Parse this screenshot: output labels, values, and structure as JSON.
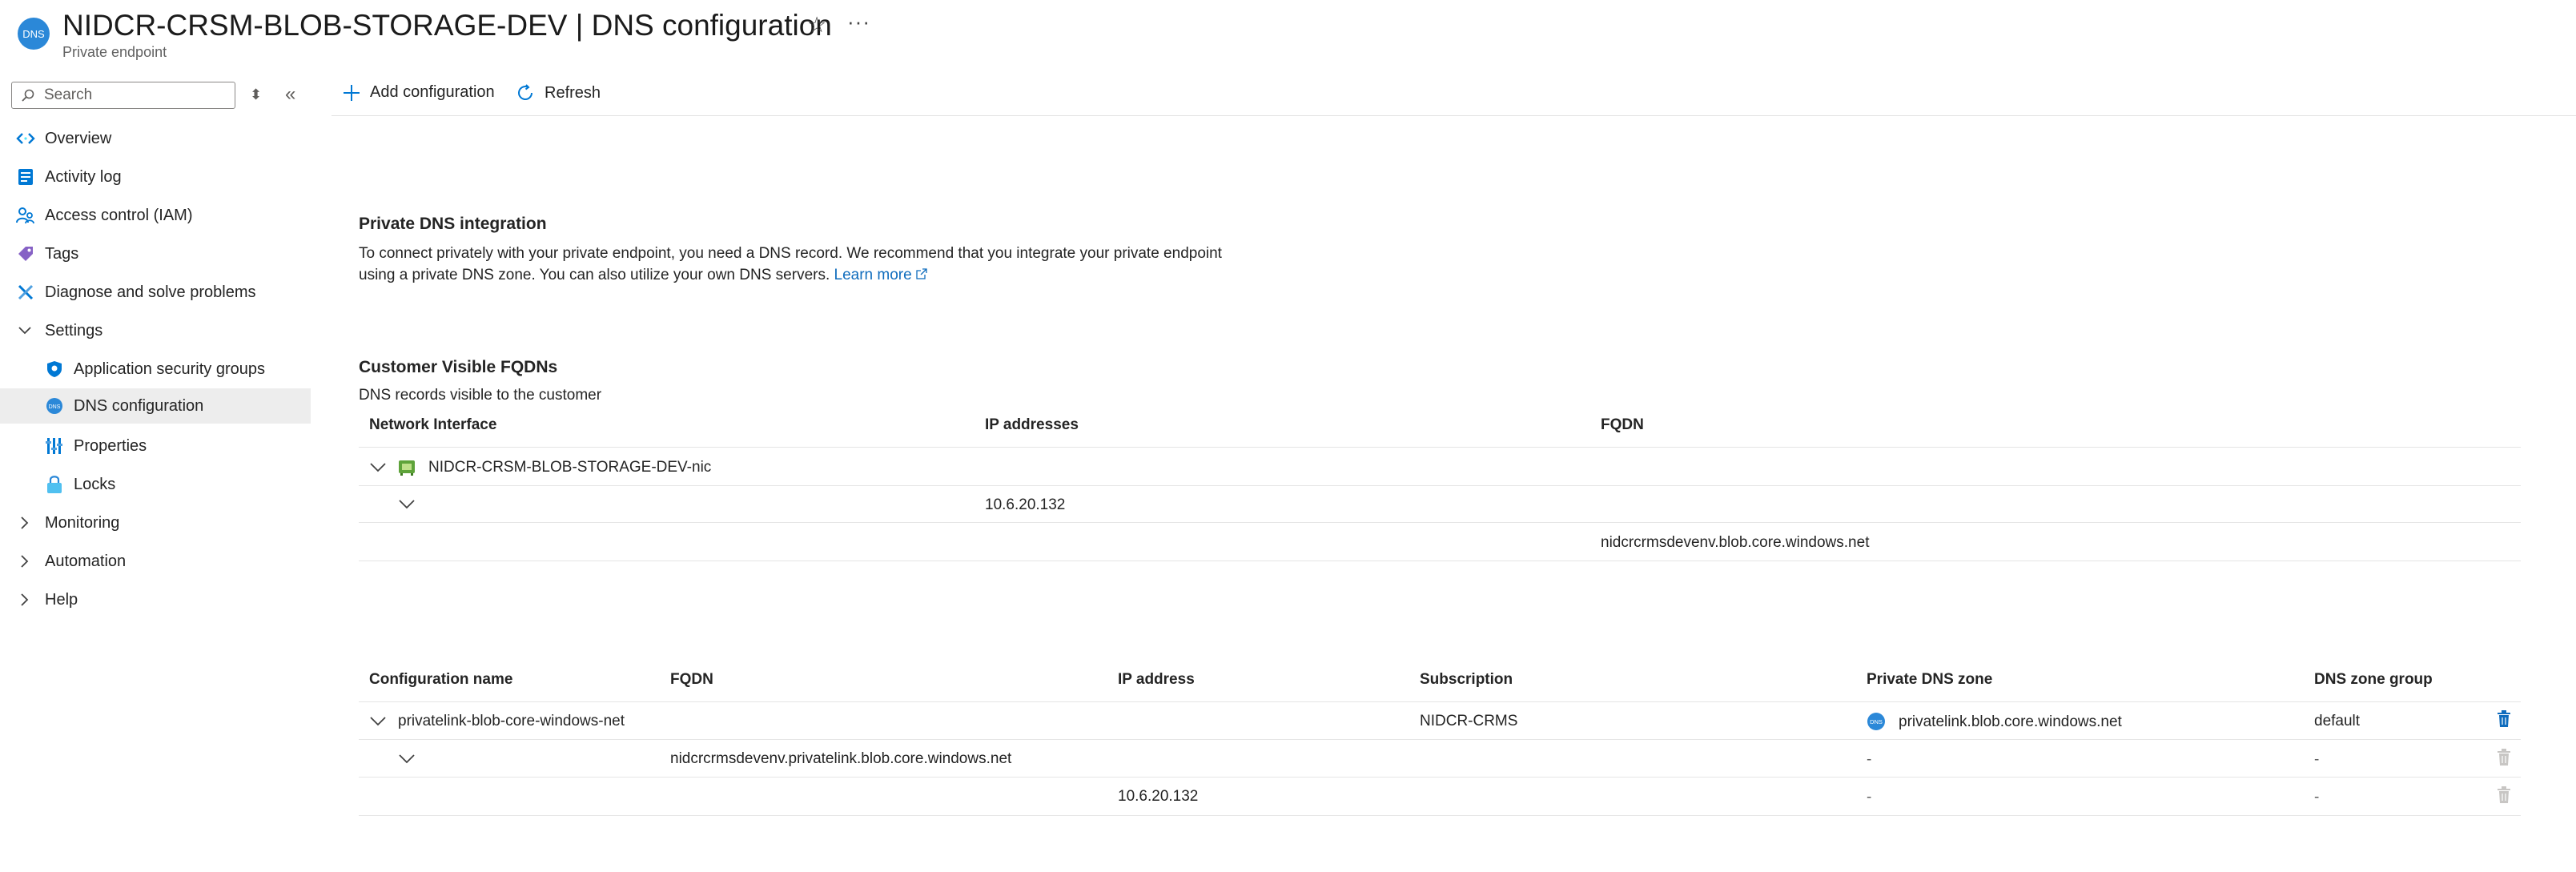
{
  "header": {
    "icon_text": "DNS",
    "title": "NIDCR-CRSM-BLOB-STORAGE-DEV | DNS configuration",
    "subtitle": "Private endpoint",
    "favorite_icon": "star-icon",
    "more_icon": "ellipsis-icon",
    "more_text": "···"
  },
  "sidebar": {
    "search_placeholder": "Search",
    "items": [
      {
        "label": "Overview",
        "icon": "overview-icon"
      },
      {
        "label": "Activity log",
        "icon": "activity-log-icon"
      },
      {
        "label": "Access control (IAM)",
        "icon": "iam-icon"
      },
      {
        "label": "Tags",
        "icon": "tag-icon"
      },
      {
        "label": "Diagnose and solve problems",
        "icon": "wrench-icon"
      },
      {
        "label": "Settings",
        "expanded": true
      },
      {
        "label": "Application security groups",
        "icon": "shield-icon"
      },
      {
        "label": "DNS configuration",
        "icon": "dns-icon",
        "active": true
      },
      {
        "label": "Properties",
        "icon": "properties-icon"
      },
      {
        "label": "Locks",
        "icon": "lock-icon"
      },
      {
        "label": "Monitoring",
        "expanded": false
      },
      {
        "label": "Automation",
        "expanded": false
      },
      {
        "label": "Help",
        "expanded": false
      }
    ]
  },
  "toolbar": {
    "add_label": "Add configuration",
    "refresh_label": "Refresh"
  },
  "dns_integration": {
    "heading": "Private DNS integration",
    "text": "To connect privately with your private endpoint, you need a DNS record. We recommend that you integrate your private endpoint using a private DNS zone. You can also utilize your own DNS servers.",
    "learn_more": "Learn more"
  },
  "fqdns": {
    "heading": "Customer Visible FQDNs",
    "subheading": "DNS records visible to the customer",
    "columns": [
      "Network Interface",
      "IP addresses",
      "FQDN"
    ],
    "nic_name": "NIDCR-CRSM-BLOB-STORAGE-DEV-nic",
    "ip": "10.6.20.132",
    "fqdn": "nidcrcrmsdevenv.blob.core.windows.net"
  },
  "configs": {
    "columns": [
      "Configuration name",
      "FQDN",
      "IP address",
      "Subscription",
      "Private DNS zone",
      "DNS zone group"
    ],
    "name": "privatelink-blob-core-windows-net",
    "subscription": "NIDCR-CRMS",
    "dns_zone": "privatelink.blob.core.windows.net",
    "zone_group": "default",
    "fqdn": "nidcrcrmsdevenv.privatelink.blob.core.windows.net",
    "ip": "10.6.20.132",
    "dash": "-"
  },
  "colors": {
    "accent": "#0f6cbd",
    "active_bg": "#ededed",
    "dns_icon_bg": "#2b88d8"
  }
}
